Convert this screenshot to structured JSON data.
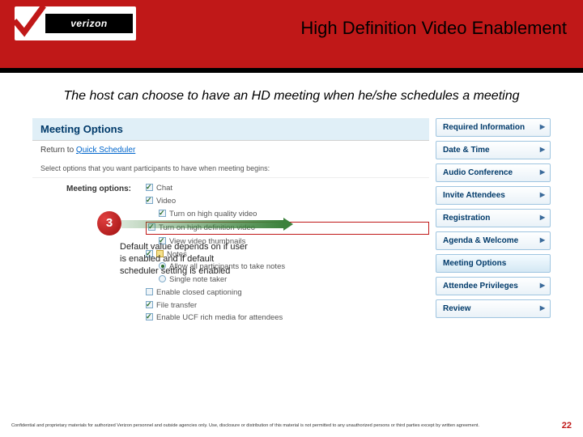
{
  "header": {
    "logo_text": "verizon",
    "title": "High Definition Video Enablement"
  },
  "intro": "The host can choose to have an HD meeting when he/she schedules a meeting",
  "panel": {
    "heading": "Meeting Options",
    "return_prefix": "Return to ",
    "return_link": "Quick Scheduler",
    "select_text": "Select options that you want participants to have when meeting begins:",
    "options_label": "Meeting options:",
    "opts": {
      "chat": "Chat",
      "video": "Video",
      "hq": "Turn on high quality video",
      "hd": "Turn on high definition video",
      "thumbs": "View video thumbnails",
      "notes": "Notes",
      "notes_all": "Allow all participants to take notes",
      "notes_single": "Single note taker",
      "cc": "Enable closed captioning",
      "ft": "File transfer",
      "ucf": "Enable UCF rich media for attendees"
    }
  },
  "tabs": {
    "req": "Required Information",
    "dt": "Date & Time",
    "ac": "Audio Conference",
    "inv": "Invite Attendees",
    "reg": "Registration",
    "aw": "Agenda & Welcome",
    "mo": "Meeting Options",
    "ap": "Attendee Privileges",
    "rev": "Review"
  },
  "callout": {
    "num": "3",
    "text": "Default value depends on if user is enabled and if default scheduler setting is enabled"
  },
  "footer": {
    "legal": "Confidential and proprietary materials for authorized Verizon personnel and outside agencies only. Use, disclosure or distribution of this material is not permitted to any unauthorized persons or third parties except by written agreement.",
    "page": "22"
  }
}
